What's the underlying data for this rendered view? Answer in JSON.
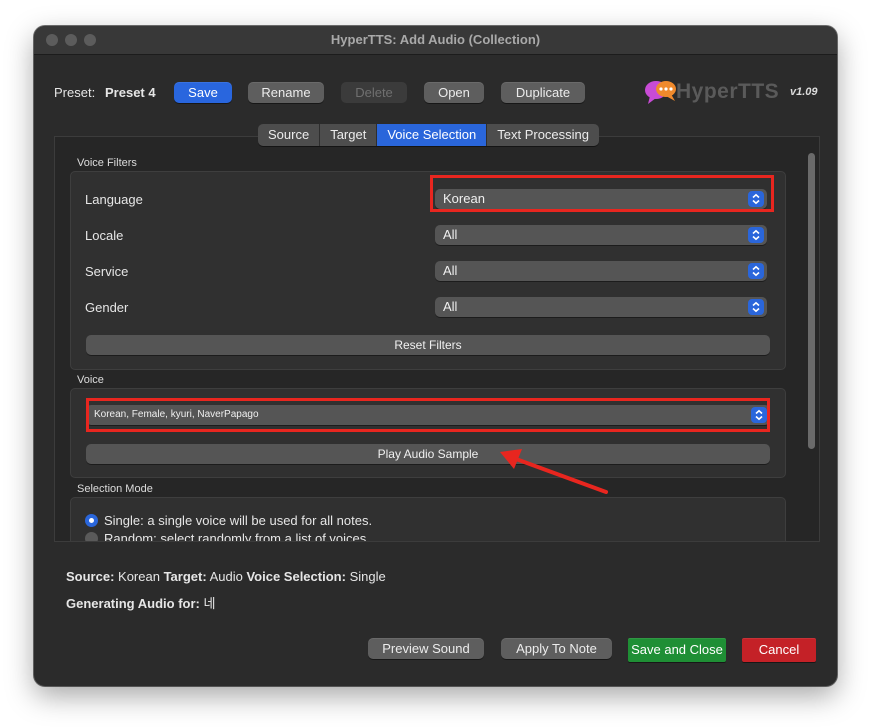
{
  "window": {
    "title": "HyperTTS: Add Audio (Collection)"
  },
  "preset": {
    "label": "Preset:",
    "name": "Preset 4",
    "buttons": {
      "save": "Save",
      "rename": "Rename",
      "delete": "Delete",
      "open": "Open",
      "duplicate": "Duplicate"
    }
  },
  "logo": {
    "text": "HyperTTS",
    "version": "v1.09"
  },
  "tabs": [
    {
      "label": "Source",
      "active": false
    },
    {
      "label": "Target",
      "active": false
    },
    {
      "label": "Voice Selection",
      "active": true
    },
    {
      "label": "Text Processing",
      "active": false
    }
  ],
  "voice_filters": {
    "title": "Voice Filters",
    "rows": [
      {
        "label": "Language",
        "value": "Korean"
      },
      {
        "label": "Locale",
        "value": "All"
      },
      {
        "label": "Service",
        "value": "All"
      },
      {
        "label": "Gender",
        "value": "All"
      }
    ],
    "reset_button": "Reset Filters"
  },
  "voice": {
    "title": "Voice",
    "selected": "Korean, Female, kyuri, NaverPapago",
    "play_button": "Play Audio Sample"
  },
  "selection_mode": {
    "title": "Selection Mode",
    "options": [
      {
        "label": "Single: a single voice will be used for all notes.",
        "selected": true
      },
      {
        "label": "Random: select randomly from a list of voices.",
        "selected": false
      }
    ]
  },
  "summary": {
    "source_label": "Source:",
    "source_value": "Korean",
    "target_label": "Target:",
    "target_value": "Audio",
    "voice_selection_label": "Voice Selection:",
    "voice_selection_value": "Single",
    "generating_label": "Generating Audio for:",
    "generating_value": "네"
  },
  "footer": {
    "preview_sound": "Preview Sound",
    "apply_to_note": "Apply To Note",
    "save_and_close": "Save and Close",
    "cancel": "Cancel"
  },
  "colors": {
    "accent_blue": "#2a66db",
    "save_close_green": "#1f8f35",
    "cancel_red": "#c42127",
    "annotation_red": "#e8261f"
  }
}
